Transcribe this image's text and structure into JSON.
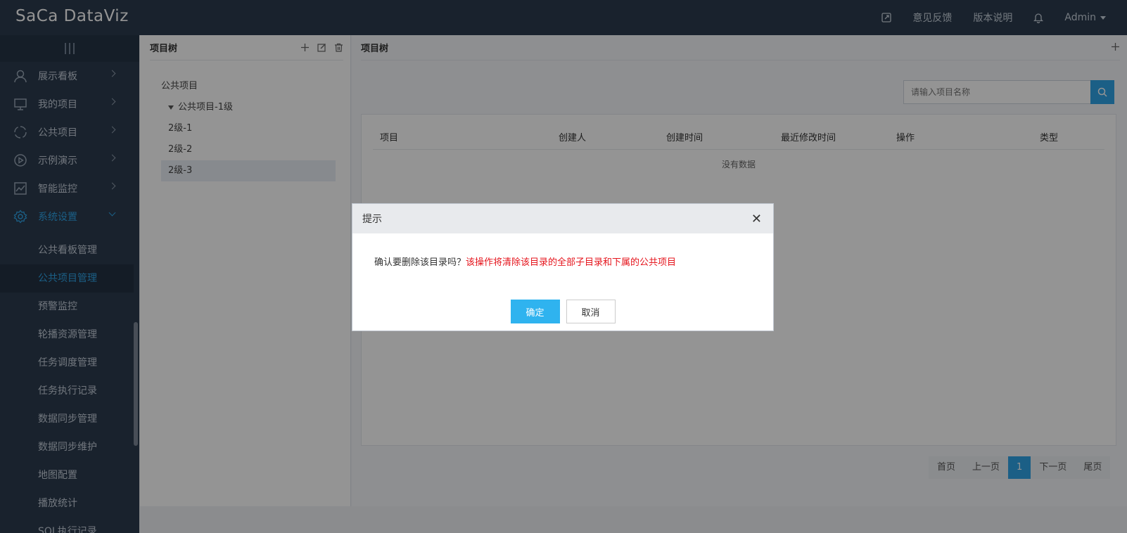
{
  "app": {
    "logo_text": "SaCa DataViz"
  },
  "topbar": {
    "feedback": "意见反馈",
    "version": "版本说明",
    "user": "Admin"
  },
  "sidebar": {
    "menu": [
      {
        "label": "展示看板",
        "icon": "user-icon"
      },
      {
        "label": "我的项目",
        "icon": "monitor-icon"
      },
      {
        "label": "公共项目",
        "icon": "circle-arrows-icon"
      },
      {
        "label": "示例演示",
        "icon": "play-icon"
      },
      {
        "label": "智能监控",
        "icon": "chart-icon"
      },
      {
        "label": "系统设置",
        "icon": "gear-icon"
      }
    ],
    "sub_items": [
      "公共看板管理",
      "公共项目管理",
      "预警监控",
      "轮播资源管理",
      "任务调度管理",
      "任务执行记录",
      "数据同步管理",
      "数据同步维护",
      "地图配置",
      "播放统计",
      "SQL执行记录"
    ]
  },
  "tree_panel": {
    "title": "项目树",
    "nodes": [
      "公共项目",
      "公共项目-1级",
      "2级-1",
      "2级-2",
      "2级-3"
    ]
  },
  "list_panel": {
    "title": "项目树",
    "search_placeholder": "请输入项目名称",
    "columns": [
      "项目",
      "创建人",
      "创建时间",
      "最近修改时间",
      "操作",
      "类型"
    ],
    "empty_text": "没有数据"
  },
  "pagination": {
    "first": "首页",
    "prev": "上一页",
    "current": "1",
    "next": "下一页",
    "last": "尾页"
  },
  "dialog": {
    "title": "提示",
    "message": "确认要删除该目录吗？",
    "warning": "该操作将清除该目录的全部子目录和下属的公共项目",
    "ok": "确定",
    "cancel": "取消"
  },
  "colors": {
    "accent": "#2fa4e7",
    "sidebar_bg": "#2b3b4e",
    "warning": "#e5141c"
  }
}
